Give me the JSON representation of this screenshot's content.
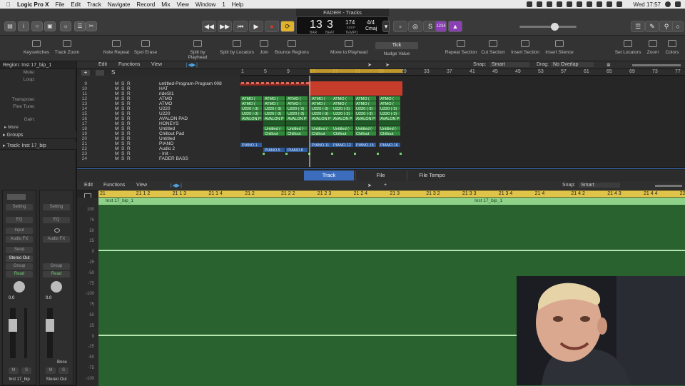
{
  "menubar": {
    "apple": "",
    "app": "Logic Pro X",
    "items": [
      "File",
      "Edit",
      "Track",
      "Navigate",
      "Record",
      "Mix",
      "View",
      "Window",
      "1",
      "Help"
    ],
    "clock": "Wed 17:57"
  },
  "window": {
    "title": "FADER - Tracks"
  },
  "lcd": {
    "bar": "13",
    "beat": "3",
    "bar_label": "BAR",
    "beat_label": "BEAT",
    "tempo": "174",
    "tempo_label": "TEMPO",
    "keep": "KEEP",
    "sig": "4/4",
    "key": "Cmaj"
  },
  "control": {
    "count_in": "1234"
  },
  "toolbar": {
    "items": [
      "Keyswitches",
      "Track Zoom",
      "Note Repeat",
      "Spot Erase",
      "Split by Playhead",
      "Split by Locators",
      "Join",
      "Bounce Regions",
      "Move to Playhead",
      "Nudge Value",
      "Repeat Section",
      "Cut Section",
      "Insert Section",
      "Insert Silence",
      "Set Locators",
      "Zoom",
      "Colors"
    ],
    "nudge_value": "Tick"
  },
  "inspector": {
    "region_header": "Region: Inst 17_bip_1",
    "rows": [
      "Mute:",
      "Loop:",
      "Transpose:",
      "Fine Tune:",
      "Gain:"
    ],
    "more": "More",
    "groups": "Groups",
    "track_header": "Track: Inst 17_bip",
    "strip1": {
      "setting": "Setting",
      "eq": "EQ",
      "input": "Input",
      "audio_fx": "Audio FX",
      "send": "Send",
      "output": "Stereo Out",
      "group": "Group",
      "auto": "Read",
      "value": "0.0",
      "name": "Inst 17_bip",
      "m": "M",
      "s": "S"
    },
    "strip2": {
      "setting": "Setting",
      "eq": "EQ",
      "audio_fx": "Audio FX",
      "group": "Group",
      "auto": "Read",
      "value": "0.0",
      "name": "Stereo Out",
      "bnce": "Bnce",
      "m": "M",
      "s": "S"
    }
  },
  "tracks_area": {
    "edit": "Edit",
    "functions": "Functions",
    "view": "View",
    "snap_label": "Snap:",
    "snap": "Smart",
    "drag_label": "Drag:",
    "drag": "No Overlap",
    "ruler": [
      "1",
      "5",
      "9",
      "13",
      "17",
      "21",
      "25",
      "29",
      "33",
      "37",
      "41",
      "45",
      "49",
      "53",
      "57",
      "61",
      "65",
      "69",
      "73",
      "77"
    ],
    "tracks": [
      {
        "n": "9",
        "name": "untitled-Program-Program 008"
      },
      {
        "n": "10",
        "name": "HAT"
      },
      {
        "n": "11",
        "name": "rideSI1"
      },
      {
        "n": "12",
        "name": "ATMO"
      },
      {
        "n": "13",
        "name": "ATMO"
      },
      {
        "n": "14",
        "name": "U220"
      },
      {
        "n": "15",
        "name": "U220"
      },
      {
        "n": "16",
        "name": "AVALON PAD"
      },
      {
        "n": "17",
        "name": "HONEYS"
      },
      {
        "n": "18",
        "name": "Untitled"
      },
      {
        "n": "19",
        "name": "Chillout Pad"
      },
      {
        "n": "20",
        "name": "Untitled"
      },
      {
        "n": "21",
        "name": "PIANO"
      },
      {
        "n": "22",
        "name": "Audio 2"
      },
      {
        "n": "23",
        "name": "- Init -"
      },
      {
        "n": "24",
        "name": "FADER BASS"
      }
    ],
    "region_labels": {
      "atmo": "ATMO (",
      "u220": "U220 (-3)",
      "avalon": "AVALON P",
      "untitled": "Untitled (-",
      "chillout": "Chillout",
      "piano": [
        "PIANO.1",
        "PIANO.5",
        "PIANO.8",
        "PIANO.11",
        "PIANO.12",
        "PIANO.15",
        "PIANO.16"
      ]
    }
  },
  "editor": {
    "tabs": [
      "Track",
      "File",
      "File Tempo"
    ],
    "active_tab": "Track",
    "edit": "Edit",
    "functions": "Functions",
    "view": "View",
    "snap_label": "Snap:",
    "snap": "Smart",
    "ruler": [
      "21",
      "21 1 2",
      "21 1 3",
      "21 1 4",
      "21 2",
      "21 2 2",
      "21 2 3",
      "21 2 4",
      "21 3",
      "21 3 2",
      "21 3 3",
      "21 3 4",
      "21 4",
      "21 4 2",
      "21 4 3",
      "21 4 4",
      "22"
    ],
    "region_name": "Inst 17_bip_1",
    "y_ticks": [
      "100",
      "75",
      "50",
      "25",
      "0",
      "-25",
      "-50",
      "-75",
      "-100",
      "75",
      "50",
      "25",
      "0",
      "-25",
      "-50",
      "-75",
      "-100"
    ]
  },
  "colors": {
    "accent": "#3c6dbd",
    "wave_bg": "#29612f",
    "region_green": "#3fa94a",
    "ruler_yellow": "#e0c44a",
    "record": "#d93b2b",
    "cycle": "#e2b32a"
  }
}
